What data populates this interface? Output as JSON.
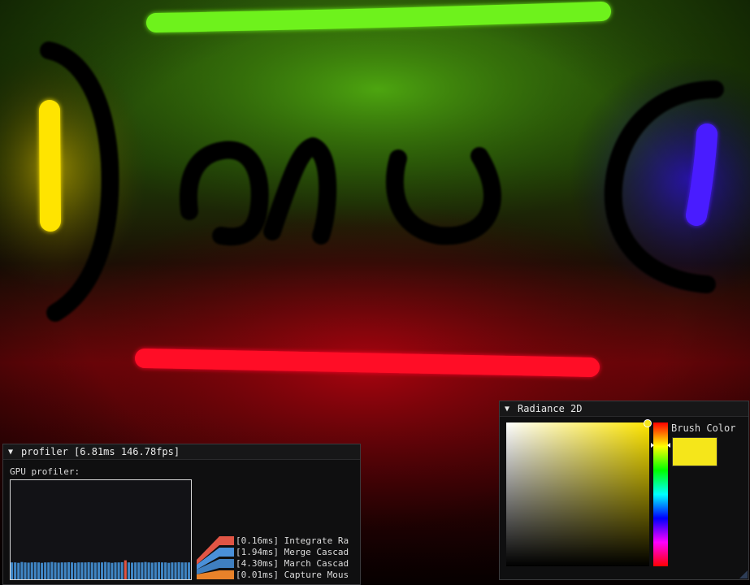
{
  "profiler": {
    "title": "profiler [6.81ms  146.78fps]",
    "section_label": "GPU profiler:",
    "bar_levels": [
      0.8,
      0.8,
      0.78,
      0.82,
      0.8,
      0.79,
      0.8,
      0.81,
      0.8,
      0.78,
      0.8,
      0.8,
      0.82,
      0.8,
      0.79,
      0.8,
      0.8,
      0.81,
      0.8,
      0.78,
      0.8,
      0.8,
      0.8,
      0.81,
      0.8,
      0.79,
      0.8,
      0.8,
      0.82,
      0.8,
      0.78,
      0.8,
      0.8,
      0.81,
      0.9,
      0.8,
      0.79,
      0.8,
      0.8,
      0.8,
      0.82,
      0.8,
      0.79,
      0.8,
      0.81,
      0.8,
      0.8,
      0.78,
      0.8,
      0.8,
      0.81,
      0.8,
      0.8,
      0.8
    ],
    "legend": [
      {
        "label": "[0.16ms] Integrate Ra",
        "color": "#e05545"
      },
      {
        "label": "[1.94ms] Merge Cascad",
        "color": "#4a90d9"
      },
      {
        "label": "[4.30ms] March Cascad",
        "color": "#3f7fc0"
      },
      {
        "label": "[0.01ms] Capture Mous",
        "color": "#e8822a"
      }
    ],
    "bar_color": "#3f85c4"
  },
  "radiance": {
    "title": "Radiance 2D",
    "brush_label": "Brush Color",
    "brush_color": "#f5e61a",
    "hue_color": "#ffe600"
  },
  "colors": {
    "green_stroke": "#6ef21a",
    "yellow_stroke": "#ffe400",
    "blue_stroke": "#4a1dff",
    "red_stroke": "#ff1026"
  }
}
